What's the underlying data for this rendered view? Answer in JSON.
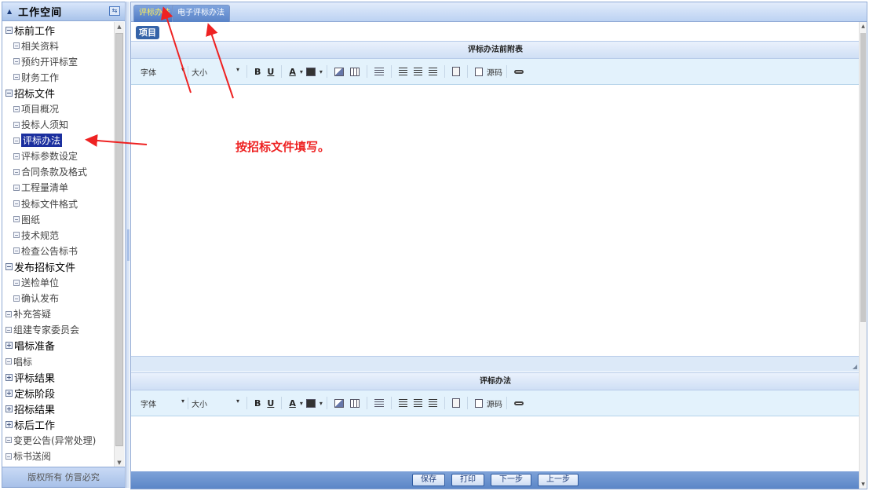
{
  "sidebar": {
    "title": "工作空间",
    "footer": "版权所有 仿冒必究",
    "items": [
      {
        "label": "标前工作",
        "level": 0,
        "icon": "minus"
      },
      {
        "label": "相关资料",
        "level": 1,
        "icon": "doc"
      },
      {
        "label": "预约开评标室",
        "level": 1,
        "icon": "doc"
      },
      {
        "label": "财务工作",
        "level": 1,
        "icon": "doc"
      },
      {
        "label": "招标文件",
        "level": 0,
        "icon": "minus"
      },
      {
        "label": "项目概况",
        "level": 1,
        "icon": "doc"
      },
      {
        "label": "投标人须知",
        "level": 1,
        "icon": "doc"
      },
      {
        "label": "评标办法",
        "level": 1,
        "icon": "doc",
        "selected": true
      },
      {
        "label": "评标参数设定",
        "level": 1,
        "icon": "doc"
      },
      {
        "label": "合同条款及格式",
        "level": 1,
        "icon": "doc"
      },
      {
        "label": "工程量清单",
        "level": 1,
        "icon": "doc"
      },
      {
        "label": "投标文件格式",
        "level": 1,
        "icon": "doc"
      },
      {
        "label": "图纸",
        "level": 1,
        "icon": "doc"
      },
      {
        "label": "技术规范",
        "level": 1,
        "icon": "doc"
      },
      {
        "label": "检查公告标书",
        "level": 1,
        "icon": "doc"
      },
      {
        "label": "发布招标文件",
        "level": 0,
        "icon": "minus"
      },
      {
        "label": "送检单位",
        "level": 1,
        "icon": "doc"
      },
      {
        "label": "确认发布",
        "level": 1,
        "icon": "doc"
      },
      {
        "label": "补充答疑",
        "level": 2,
        "icon": "doc"
      },
      {
        "label": "组建专家委员会",
        "level": 2,
        "icon": "doc"
      },
      {
        "label": "唱标准备",
        "level": 0,
        "icon": "plus"
      },
      {
        "label": "唱标",
        "level": 2,
        "icon": "doc"
      },
      {
        "label": "评标结果",
        "level": 0,
        "icon": "plus"
      },
      {
        "label": "定标阶段",
        "level": 0,
        "icon": "plus"
      },
      {
        "label": "招标结果",
        "level": 0,
        "icon": "plus"
      },
      {
        "label": "标后工作",
        "level": 0,
        "icon": "plus"
      },
      {
        "label": "变更公告(异常处理)",
        "level": 2,
        "icon": "doc"
      },
      {
        "label": "标书送阅",
        "level": 2,
        "icon": "doc"
      }
    ]
  },
  "tabs": {
    "active": "评标办法",
    "inactive": "电子评标办法"
  },
  "main": {
    "badge": "项目",
    "panel1_title": "评标办法前附表",
    "panel2_title": "评标办法"
  },
  "toolbar": {
    "font_label": "字体",
    "size_label": "大小",
    "bold": "B",
    "underline": "U",
    "font_color": "A",
    "source_label": "源码",
    "dropdown": "▾"
  },
  "buttons": {
    "save": "保存",
    "print": "打印",
    "next": "下一步",
    "prev": "上一步"
  },
  "annotation": {
    "note": "按招标文件填写。"
  },
  "colors": {
    "accent": "#3563a8",
    "annotation": "#e22222",
    "selected_bg": "#1b2f9e"
  }
}
